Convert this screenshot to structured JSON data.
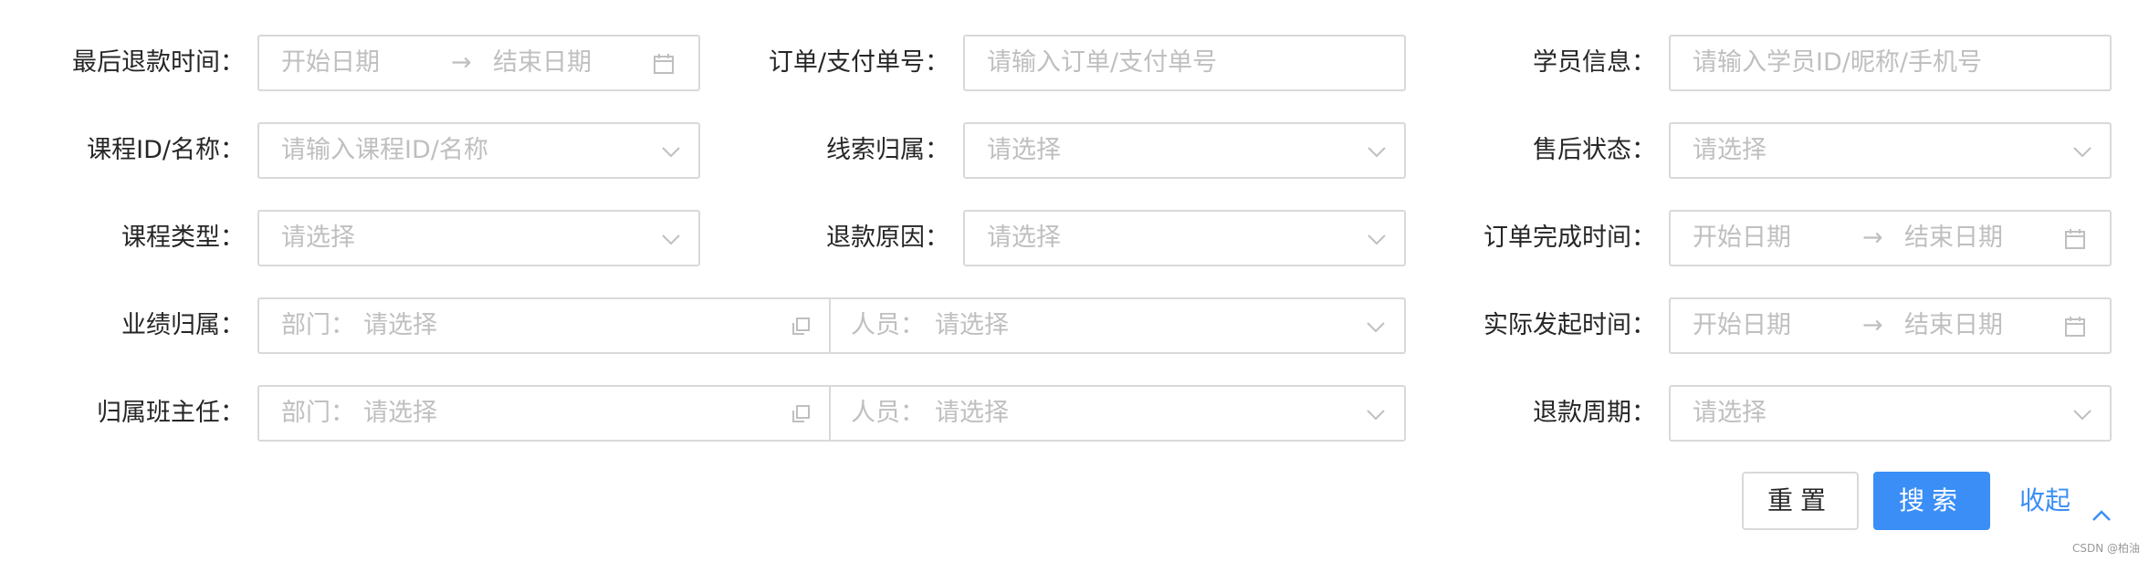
{
  "form": {
    "row1": {
      "refund_time_label": "最后退款时间：",
      "refund_time_start": "开始日期",
      "refund_time_sep": "→",
      "refund_time_end": "结束日期",
      "order_no_label": "订单/支付单号：",
      "order_no_placeholder": "请输入订单/支付单号",
      "student_label": "学员信息：",
      "student_placeholder": "请输入学员ID/昵称/手机号"
    },
    "row2": {
      "course_label": "课程ID/名称：",
      "course_placeholder": "请输入课程ID/名称",
      "lead_label": "线索归属：",
      "lead_placeholder": "请选择",
      "aftersale_label": "售后状态：",
      "aftersale_placeholder": "请选择"
    },
    "row3": {
      "course_type_label": "课程类型：",
      "course_type_placeholder": "请选择",
      "reason_label": "退款原因：",
      "reason_placeholder": "请选择",
      "complete_time_label": "订单完成时间：",
      "complete_time_start": "开始日期",
      "complete_time_sep": "→",
      "complete_time_end": "结束日期"
    },
    "row4": {
      "perf_label": "业绩归属：",
      "perf_dept_prefix": "部门：",
      "perf_dept_placeholder": "请选择",
      "perf_person_prefix": "人员：",
      "perf_person_placeholder": "请选择",
      "actual_time_label": "实际发起时间：",
      "actual_time_start": "开始日期",
      "actual_time_sep": "→",
      "actual_time_end": "结束日期"
    },
    "row5": {
      "teacher_label": "归属班主任：",
      "teacher_dept_prefix": "部门：",
      "teacher_dept_placeholder": "请选择",
      "teacher_person_prefix": "人员：",
      "teacher_person_placeholder": "请选择",
      "cycle_label": "退款周期：",
      "cycle_placeholder": "请选择"
    }
  },
  "actions": {
    "reset_label": "重置",
    "search_label": "搜索",
    "collapse_label": "收起"
  },
  "watermark": "CSDN @柏油",
  "colors": {
    "primary": "#3a8ef6",
    "border": "#d9d9d9",
    "placeholder": "#bfbfbf",
    "text": "#262626"
  },
  "icons": [
    "calendar-icon",
    "chevron-down-icon",
    "tree-select-icon",
    "arrow-right-icon",
    "chevron-up-icon"
  ]
}
